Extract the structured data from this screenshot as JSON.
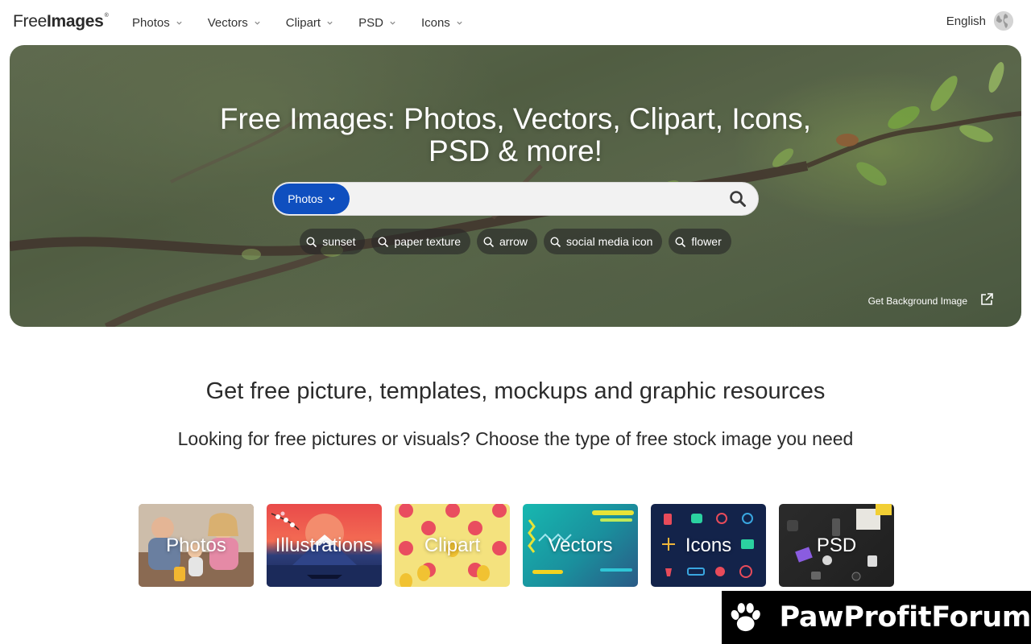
{
  "header": {
    "logo_free": "Free",
    "logo_images": "Images",
    "logo_reg": "®",
    "nav": [
      {
        "label": "Photos"
      },
      {
        "label": "Vectors"
      },
      {
        "label": "Clipart"
      },
      {
        "label": "PSD"
      },
      {
        "label": "Icons"
      }
    ],
    "language": "English"
  },
  "hero": {
    "title_line1": "Free Images: Photos, Vectors, Clipart, Icons,",
    "title_line2": "PSD & more!",
    "search": {
      "type_selected": "Photos",
      "value": "",
      "placeholder": ""
    },
    "tags": [
      "sunset",
      "paper texture",
      "arrow",
      "social media icon",
      "flower"
    ],
    "background_link": "Get Background Image",
    "accent_color": "#0f4fbf"
  },
  "main": {
    "headline": "Get free picture, templates, mockups and graphic resources",
    "subline": "Looking for free pictures or visuals? Choose the type of free stock image you need",
    "categories": [
      {
        "label": "Photos"
      },
      {
        "label": "Illustrations"
      },
      {
        "label": "Clipart"
      },
      {
        "label": "Vectors"
      },
      {
        "label": "Icons"
      },
      {
        "label": "PSD"
      }
    ]
  },
  "watermark": {
    "text": "PawProfitForum"
  }
}
